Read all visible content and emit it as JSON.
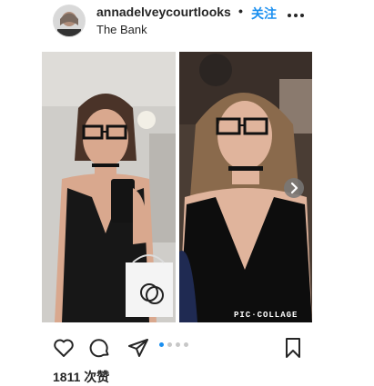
{
  "header": {
    "username": "annadelveycourtlooks",
    "separator": "•",
    "follow_label": "关注",
    "location": "The Bank"
  },
  "post": {
    "watermark": "PIC·COLLAGE",
    "carousel": {
      "count": 4,
      "active_index": 0
    }
  },
  "icons": {
    "like": "heart-icon",
    "comment": "comment-icon",
    "share": "send-icon",
    "save": "bookmark-icon",
    "next": "chevron-right-icon",
    "more": "more-dots-icon"
  },
  "footer": {
    "likes_text": "1811 次赞"
  },
  "colors": {
    "accent": "#1a8ff0",
    "text": "#262626"
  }
}
